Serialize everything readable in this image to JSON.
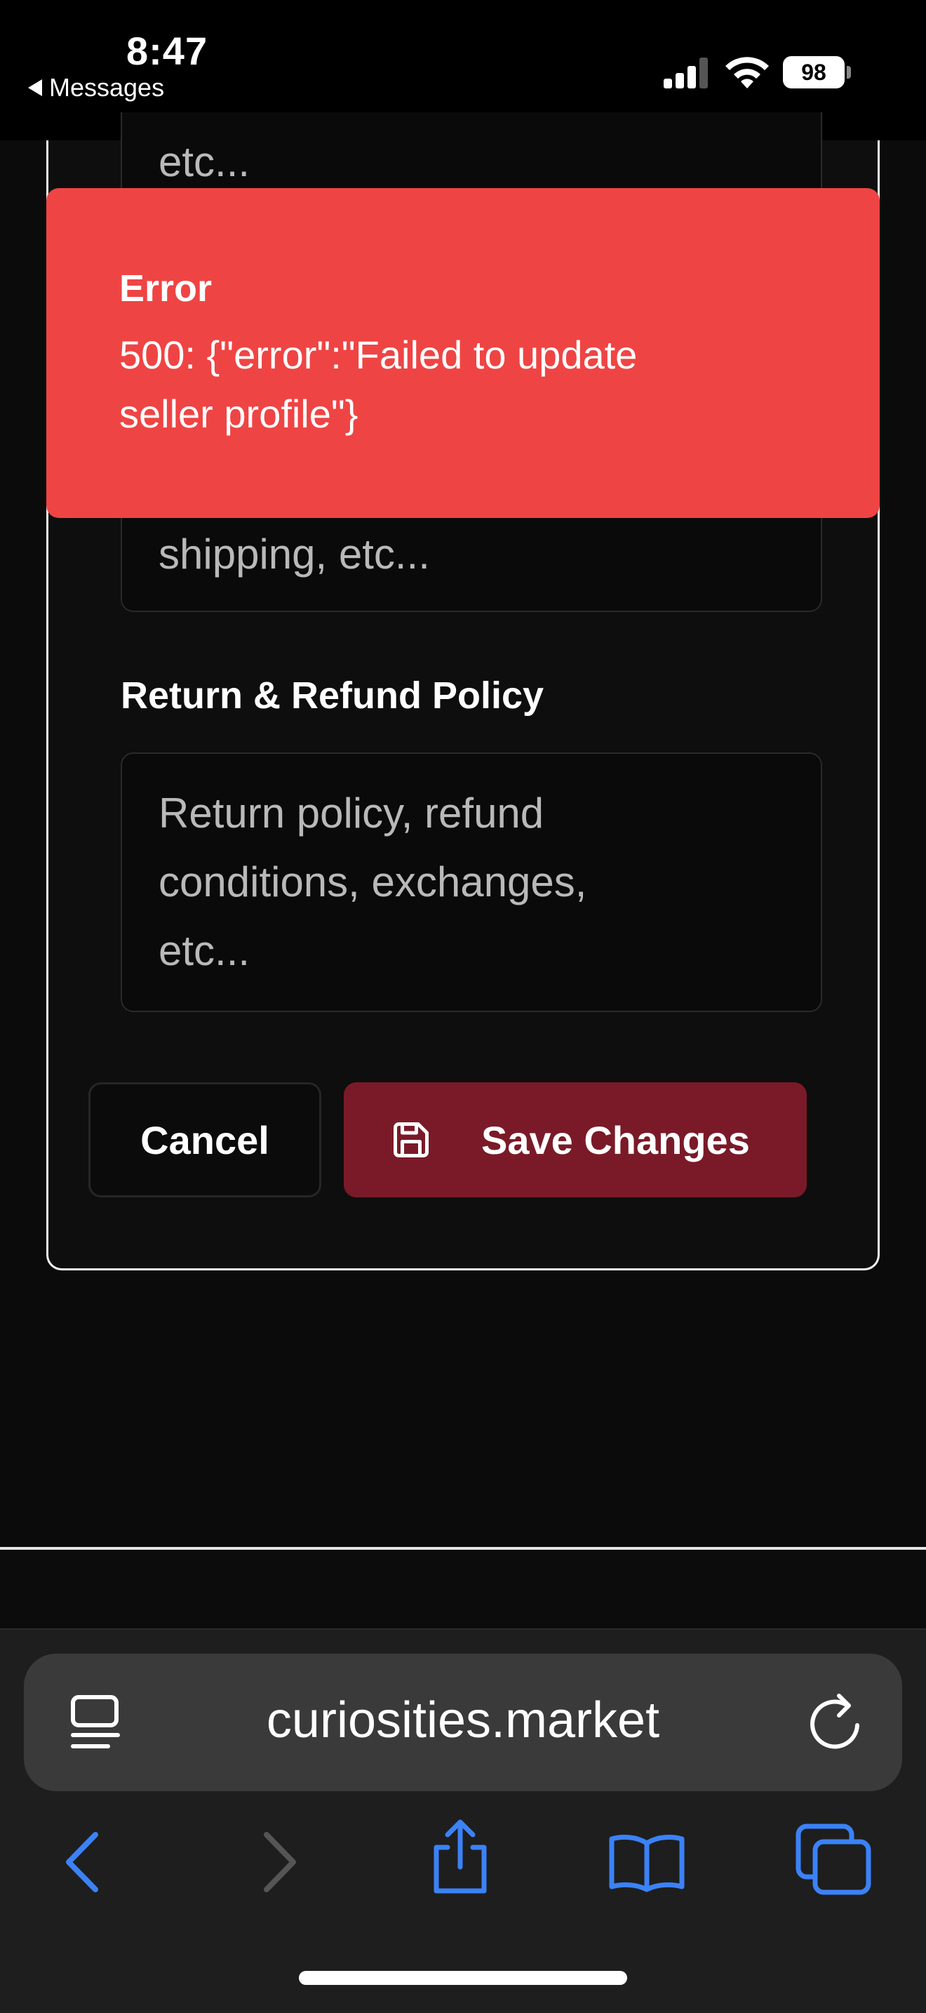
{
  "status_bar": {
    "time": "8:47",
    "back_app": "Messages",
    "battery": "98"
  },
  "form": {
    "shipping_placeholder_fragment": "shipping, etc...",
    "top_fragment": "etc...",
    "return_policy_label": "Return & Refund Policy",
    "return_policy_placeholder_lines": [
      "Return policy, refund",
      "conditions, exchanges,",
      "etc..."
    ],
    "cancel_label": "Cancel",
    "save_label": "Save Changes"
  },
  "toast": {
    "title": "Error",
    "message_lines": [
      "500: {\"error\":\"Failed to update",
      "seller profile\"}"
    ],
    "color": "#ef4444"
  },
  "browser": {
    "url": "curiosities.market",
    "accent_color": "#3b82f6"
  },
  "colors": {
    "save_button": "#7a1a28",
    "background": "#0c0c0c"
  }
}
